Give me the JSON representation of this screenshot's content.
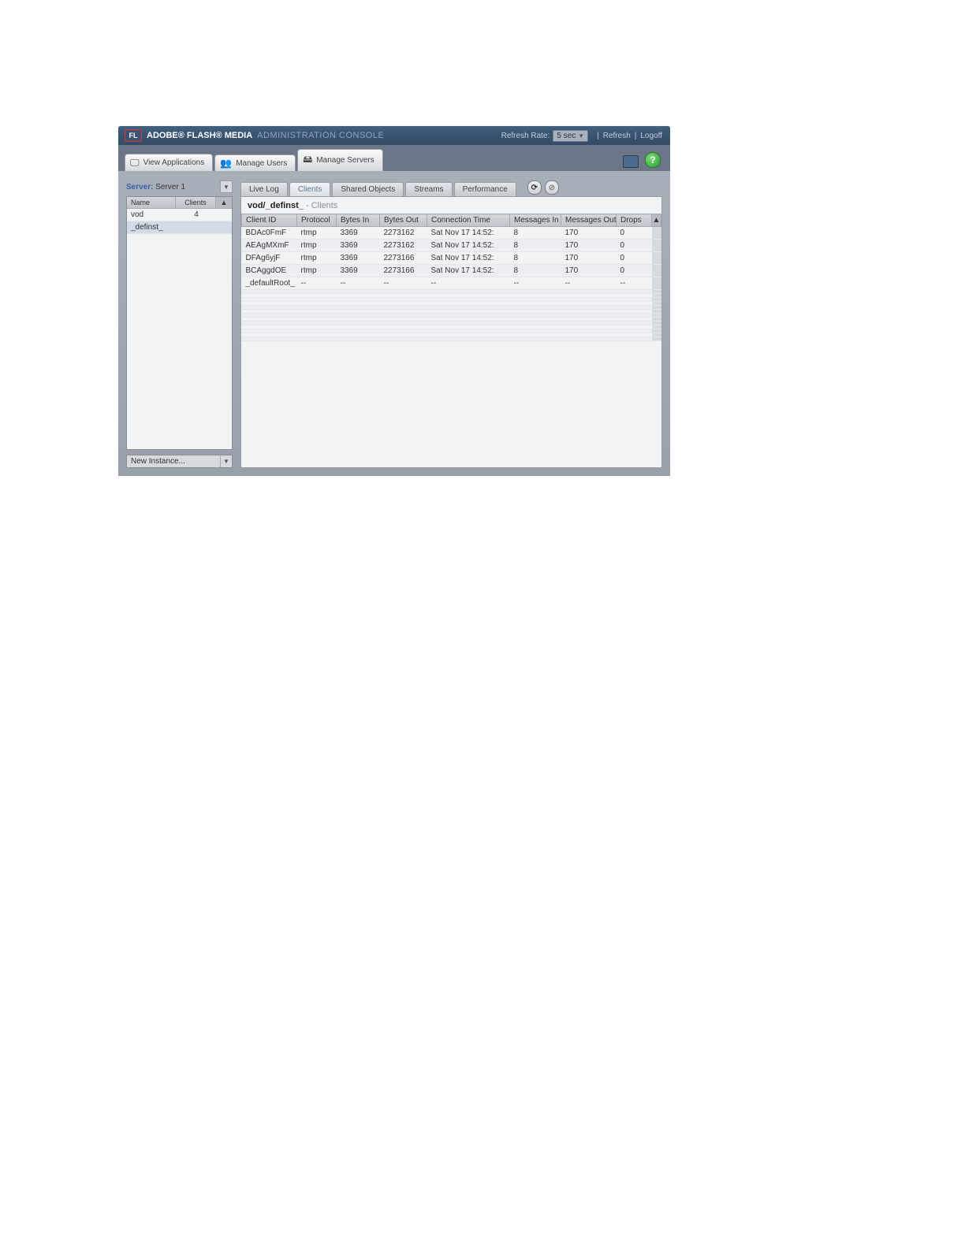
{
  "brand": {
    "logo": "FL",
    "text1": "ADOBE® FLASH® MEDIA",
    "text2": "ADMINISTRATION CONSOLE"
  },
  "top": {
    "refresh_label": "Refresh Rate:",
    "rate_value": "5 sec",
    "refresh_link": "Refresh",
    "logoff_link": "Logoff"
  },
  "nav": {
    "view_apps": "View Applications",
    "manage_users": "Manage Users",
    "manage_servers": "Manage Servers"
  },
  "server": {
    "label": "Server:",
    "value": "Server 1"
  },
  "applist": {
    "headers": {
      "name": "Name",
      "clients": "Clients"
    },
    "rows": [
      {
        "name": "vod",
        "clients": "4"
      },
      {
        "name": "_definst_",
        "clients": ""
      }
    ]
  },
  "new_instance_label": "New Instance...",
  "subtabs": {
    "live_log": "Live Log",
    "clients": "Clients",
    "shared_objects": "Shared Objects",
    "streams": "Streams",
    "performance": "Performance"
  },
  "panel_title": {
    "instance": "vod/_definst_",
    "section": "- Clients"
  },
  "grid": {
    "headers": {
      "client_id": "Client ID",
      "protocol": "Protocol",
      "bytes_in": "Bytes In",
      "bytes_out": "Bytes Out",
      "connection_time": "Connection Time",
      "messages_in": "Messages In",
      "messages_out": "Messages Out",
      "drops": "Drops"
    },
    "rows": [
      {
        "client_id": "BDAc0FmF",
        "protocol": "rtmp",
        "bytes_in": "3369",
        "bytes_out": "2273162",
        "connection_time": "Sat Nov 17 14:52:",
        "messages_in": "8",
        "messages_out": "170",
        "drops": "0"
      },
      {
        "client_id": "AEAgMXmF",
        "protocol": "rtmp",
        "bytes_in": "3369",
        "bytes_out": "2273162",
        "connection_time": "Sat Nov 17 14:52:",
        "messages_in": "8",
        "messages_out": "170",
        "drops": "0"
      },
      {
        "client_id": "DFAg6yjF",
        "protocol": "rtmp",
        "bytes_in": "3369",
        "bytes_out": "2273166",
        "connection_time": "Sat Nov 17 14:52:",
        "messages_in": "8",
        "messages_out": "170",
        "drops": "0"
      },
      {
        "client_id": "BCAggdOE",
        "protocol": "rtmp",
        "bytes_in": "3369",
        "bytes_out": "2273166",
        "connection_time": "Sat Nov 17 14:52:",
        "messages_in": "8",
        "messages_out": "170",
        "drops": "0"
      },
      {
        "client_id": "_defaultRoot_",
        "protocol": "--",
        "bytes_in": "--",
        "bytes_out": "--",
        "connection_time": "--",
        "messages_in": "--",
        "messages_out": "--",
        "drops": "--"
      }
    ]
  }
}
